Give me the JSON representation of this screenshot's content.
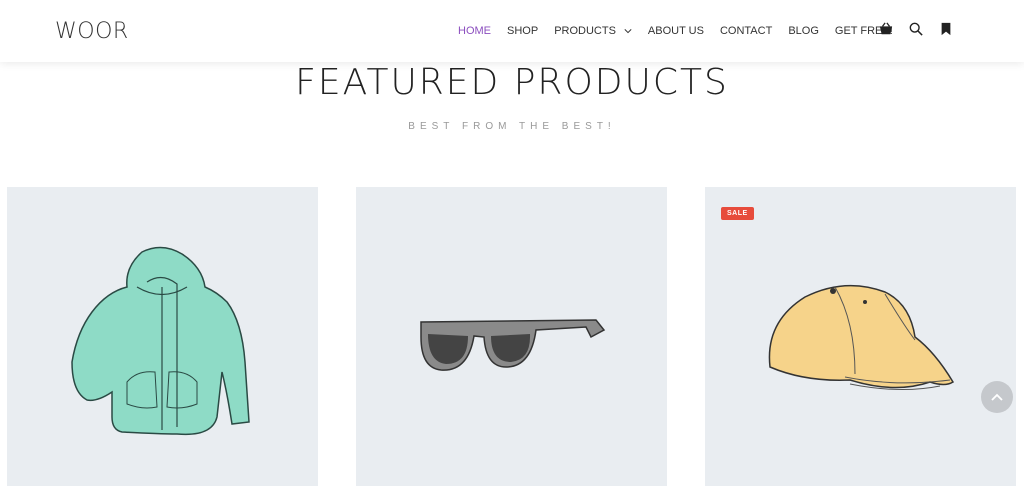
{
  "header": {
    "logo": "WOOR",
    "nav": [
      {
        "label": "HOME"
      },
      {
        "label": "SHOP"
      },
      {
        "label": "PRODUCTS"
      },
      {
        "label": "ABOUT US"
      },
      {
        "label": "CONTACT"
      },
      {
        "label": "BLOG"
      },
      {
        "label": "GET FREE!"
      }
    ],
    "icons": [
      "cart-icon",
      "search-icon",
      "bookmark-icon"
    ]
  },
  "section": {
    "title": "FEATURED PRODUCTS",
    "subtitle": "BEST FROM THE BEST!"
  },
  "products": [
    {
      "image": "hoodie-image"
    },
    {
      "image": "sunglasses-image"
    },
    {
      "image": "cap-image",
      "badge": "SALE"
    }
  ],
  "colors": {
    "accent": "#8c4fbf",
    "sale_badge": "#e74c3c",
    "card_bg": "#e9edf1"
  }
}
